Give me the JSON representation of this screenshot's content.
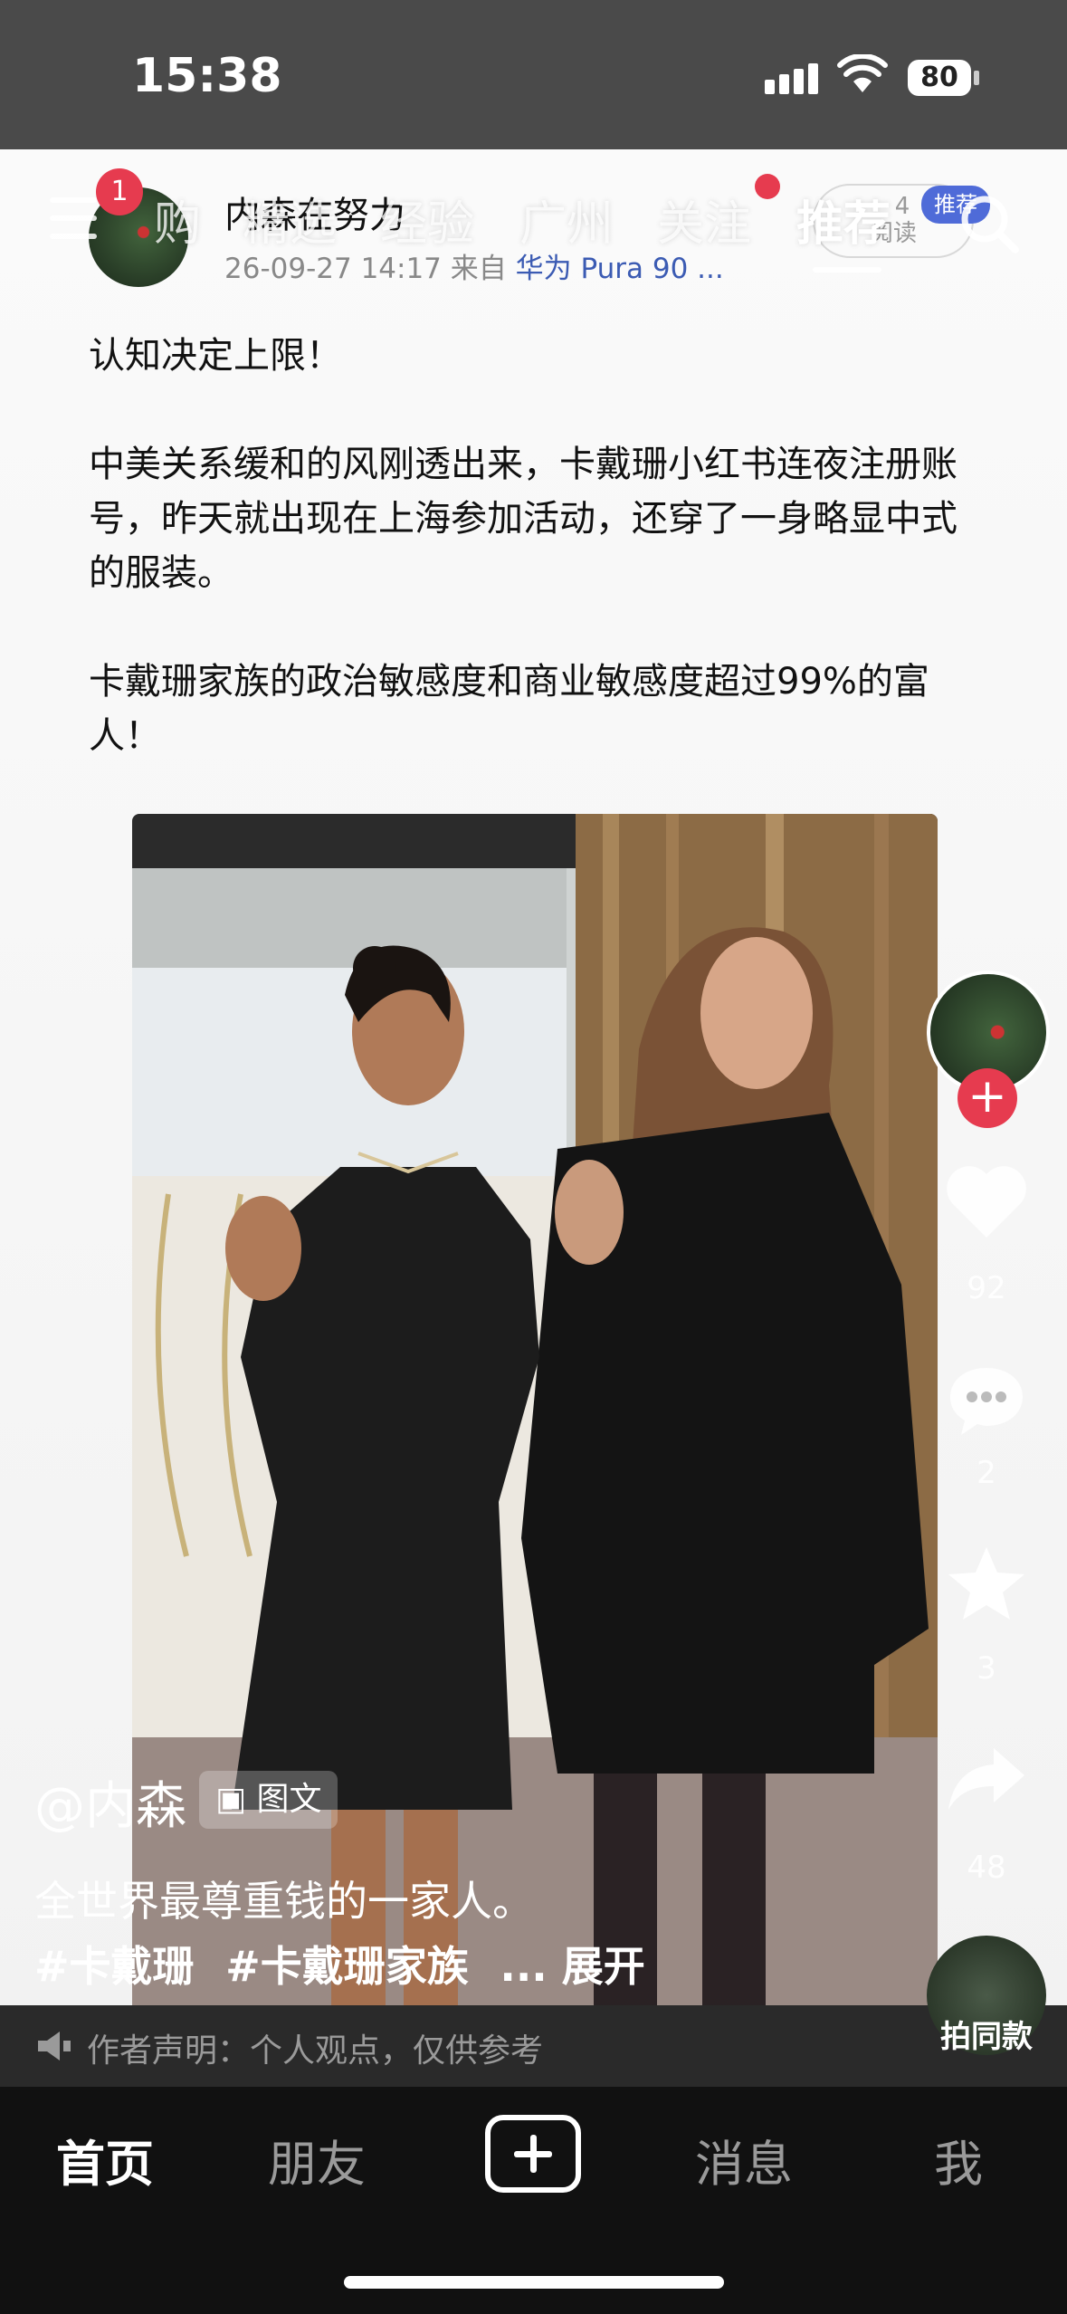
{
  "status_bar": {
    "time": "15:38",
    "battery": "80"
  },
  "top_tabs": [
    {
      "label": "购"
    },
    {
      "label": "精选"
    },
    {
      "label": "经验"
    },
    {
      "label": "广州"
    },
    {
      "label": "关注"
    },
    {
      "label": "推荐"
    }
  ],
  "menu_badge": "1",
  "post": {
    "author": "内森在努力",
    "date": "26-09-27 14:17",
    "source_prefix": "来自",
    "device": "华为 Pura 90 ...",
    "read_count": "4",
    "read_label": "阅读",
    "push_tag": "推荐",
    "paragraphs": [
      "认知决定上限！",
      "中美关系缓和的风刚透出来，卡戴珊小红书连夜注册账号，昨天就出现在上海参加活动，还穿了一身略显中式的服装。",
      "卡戴珊家族的政治敏感度和商业敏感度超过99%的富人！"
    ]
  },
  "side_actions": {
    "likes": "92",
    "comments": "2",
    "favorites": "3",
    "shares": "48"
  },
  "overlay": {
    "author_handle": "@内森",
    "type_badge": "图文",
    "caption": "全世界最尊重钱的一家人。",
    "tags": [
      "#卡戴珊",
      "#卡戴珊家族"
    ],
    "expand_label": "... 展开",
    "disclaimer": "作者声明：个人观点，仅供参考",
    "same_style": "拍同款"
  },
  "bottom_nav": {
    "home": "首页",
    "friends": "朋友",
    "messages": "消息",
    "me": "我"
  }
}
